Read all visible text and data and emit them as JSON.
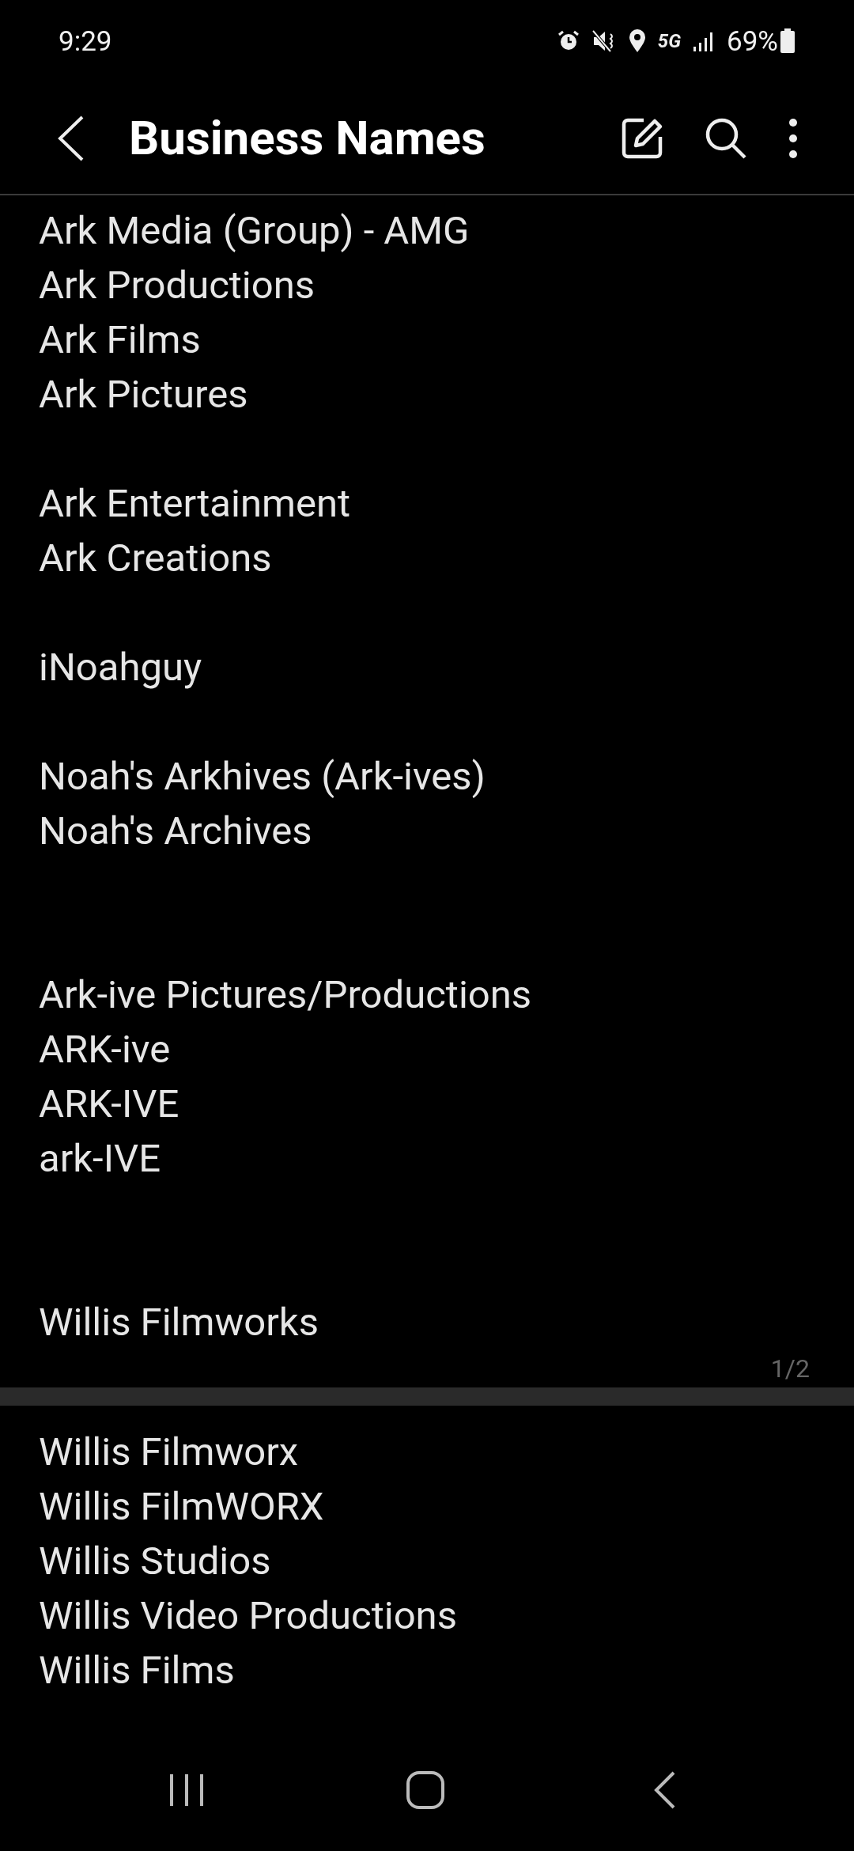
{
  "status_bar": {
    "time": "9:29",
    "network": "5G",
    "battery": "69%"
  },
  "toolbar": {
    "title": "Business Names"
  },
  "pages": [
    {
      "page_number": "1/2",
      "lines": [
        {
          "kind": "text",
          "text": "Ark Media (Group) - AMG"
        },
        {
          "kind": "text",
          "text": "Ark Productions"
        },
        {
          "kind": "text",
          "text": "Ark Films"
        },
        {
          "kind": "text",
          "text": "Ark Pictures"
        },
        {
          "kind": "blank"
        },
        {
          "kind": "text",
          "text": "Ark Entertainment"
        },
        {
          "kind": "text",
          "text": "Ark Creations"
        },
        {
          "kind": "blank"
        },
        {
          "kind": "text",
          "text": "iNoahguy"
        },
        {
          "kind": "blank"
        },
        {
          "kind": "text",
          "text": "Noah's Arkhives (Ark-ives)"
        },
        {
          "kind": "text",
          "text": "Noah's Archives"
        },
        {
          "kind": "blank"
        },
        {
          "kind": "blank"
        },
        {
          "kind": "text",
          "text": "Ark-ive Pictures/Productions"
        },
        {
          "kind": "text",
          "text": "ARK-ive"
        },
        {
          "kind": "text",
          "text": "ARK-IVE"
        },
        {
          "kind": "text",
          "text": "ark-IVE"
        },
        {
          "kind": "blank"
        },
        {
          "kind": "blank"
        },
        {
          "kind": "text",
          "text": "Willis Filmworks"
        }
      ]
    },
    {
      "lines": [
        {
          "kind": "text",
          "text": "Willis Filmworx"
        },
        {
          "kind": "text",
          "text": "Willis FilmWORX"
        },
        {
          "kind": "text",
          "text": "Willis Studios"
        },
        {
          "kind": "text",
          "text": "Willis Video Productions"
        },
        {
          "kind": "text",
          "text": "Willis Films"
        }
      ]
    }
  ]
}
